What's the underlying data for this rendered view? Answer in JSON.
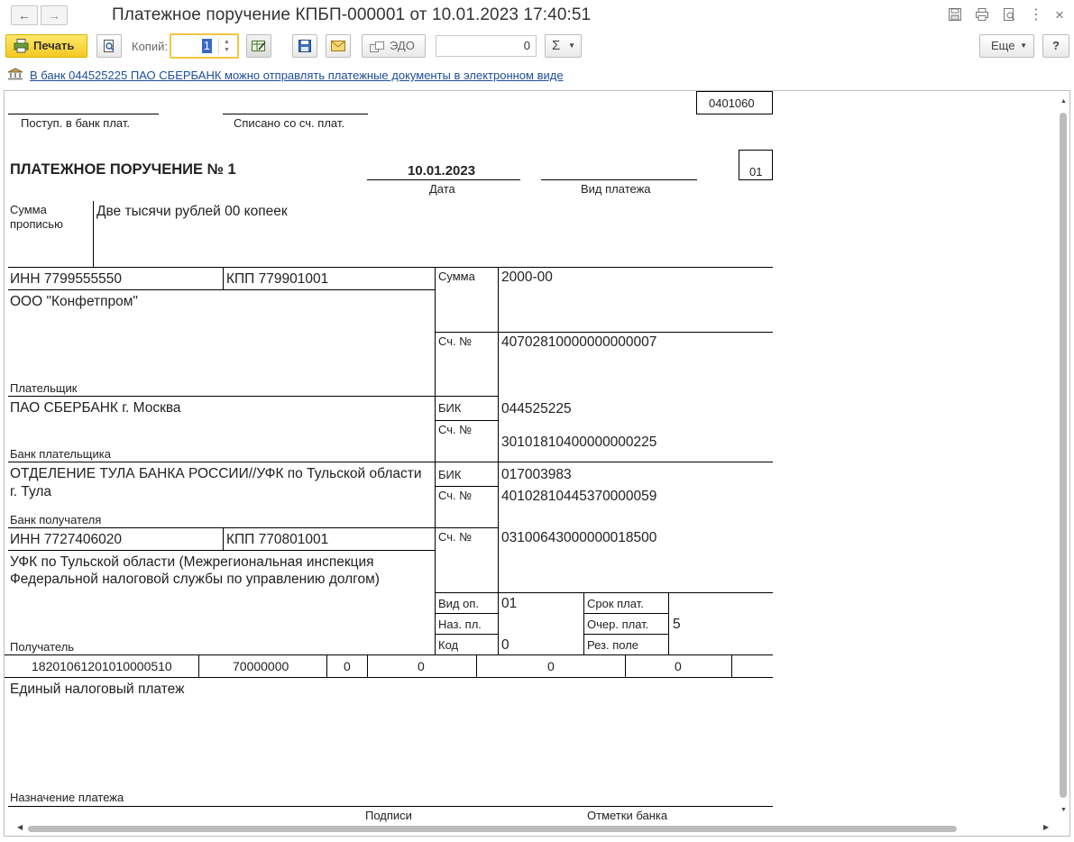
{
  "window": {
    "title": "Платежное поручение КПБП-000001 от 10.01.2023 17:40:51",
    "nav_back": "←",
    "nav_forward": "→",
    "icons": [
      "save-icon",
      "print-icon",
      "preview-icon",
      "more-vert-icon",
      "close-icon"
    ],
    "more_glyph": "⋮",
    "close_glyph": "×"
  },
  "toolbar": {
    "print_label": "Печать",
    "copies_label": "Копий:",
    "copies_value": "1",
    "edo_label": "ЭДО",
    "sum_value": "0",
    "sigma_label": "Σ",
    "more_label": "Еще",
    "help_label": "?"
  },
  "info": {
    "link_text": "В банк 044525225 ПАО СБЕРБАНК можно отправлять платежные документы в электронном виде"
  },
  "form": {
    "okud": "0401060",
    "received_label": "Поступ. в банк плат.",
    "debited_label": "Списано со сч. плат.",
    "title": "ПЛАТЕЖНОЕ ПОРУЧЕНИЕ № 1",
    "date": "10.01.2023",
    "date_label": "Дата",
    "payment_type_label": "Вид платежа",
    "status_code": "01",
    "sum_words_label_1": "Сумма",
    "sum_words_label_2": "прописью",
    "sum_words": "Две тысячи рублей 00 копеек",
    "payer_inn": "ИНН 7799555550",
    "payer_kpp": "КПП 779901001",
    "sum_label": "Сумма",
    "sum": "2000-00",
    "payer_name": "ООО \"Конфетпром\"",
    "payer_label": "Плательщик",
    "account_label": "Сч. №",
    "payer_account": "40702810000000000007",
    "payer_bank": "ПАО СБЕРБАНК г. Москва",
    "payer_bank_label": "Банк плательщика",
    "bik_label": "БИК",
    "payer_bik": "044525225",
    "payer_corr_account": "30101810400000000225",
    "payee_bank_line1": "ОТДЕЛЕНИЕ ТУЛА БАНКА РОССИИ//УФК по Тульской области",
    "payee_bank_line2": "г. Тула",
    "payee_bank_label": "Банк получателя",
    "payee_bik": "017003983",
    "payee_corr_account": "40102810445370000059",
    "payee_inn": "ИНН 7727406020",
    "payee_kpp": "КПП 770801001",
    "payee_account": "03100643000000018500",
    "payee_name_line1": "УФК по Тульской области (Межрегиональная инспекция",
    "payee_name_line2": "Федеральной налоговой службы по управлению долгом)",
    "payee_label": "Получатель",
    "op_type_label": "Вид оп.",
    "op_type": "01",
    "term_label": "Срок плат.",
    "purpose_code_label": "Наз. пл.",
    "priority_label": "Очер. плат.",
    "priority": "5",
    "code_label": "Код",
    "code": "0",
    "reserve_label": "Рез. поле",
    "kbk": "18201061201010000510",
    "oktmo": "70000000",
    "field106": "0",
    "field107": "0",
    "field108": "0",
    "field109": "0",
    "purpose": "Единый налоговый платеж",
    "purpose_label": "Назначение платежа",
    "signatures_label": "Подписи",
    "bank_marks_label": "Отметки банка"
  }
}
